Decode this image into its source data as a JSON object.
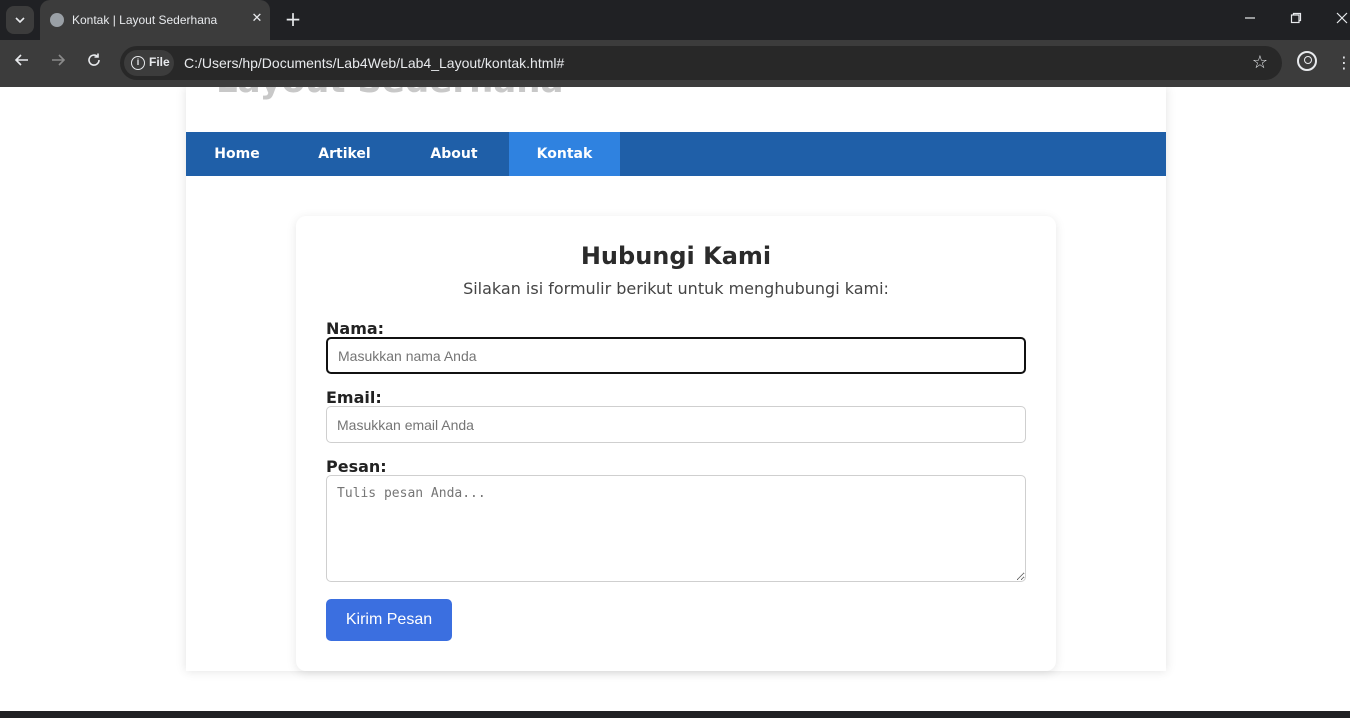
{
  "browser": {
    "tab_title": "Kontak | Layout Sederhana",
    "tab_close": "✕",
    "new_tab": "+",
    "site_chip": "File",
    "url": "C:/Users/hp/Documents/Lab4Web/Lab4_Layout/kontak.html#",
    "icons": [
      "tab-list-icon",
      "globe-icon",
      "close-icon",
      "plus-icon",
      "minimize-icon",
      "restore-icon",
      "close-window-icon",
      "back-icon",
      "forward-icon",
      "reload-icon",
      "info-icon",
      "star-icon",
      "profile-icon",
      "kebab-menu-icon"
    ]
  },
  "site": {
    "title": "Layout Sederhana",
    "nav": [
      "Home",
      "Artikel",
      "About",
      "Kontak"
    ],
    "active_nav": "Kontak",
    "colors": {
      "nav_bg": "#1f5fa8",
      "nav_active": "#2f82e0",
      "button": "#3b6fe0"
    }
  },
  "form": {
    "title": "Hubungi Kami",
    "subtitle": "Silakan isi formulir berikut untuk menghubungi kami:",
    "name_label": "Nama:",
    "name_placeholder": "Masukkan nama Anda",
    "email_label": "Email:",
    "email_placeholder": "Masukkan email Anda",
    "message_label": "Pesan:",
    "message_placeholder": "Tulis pesan Anda...",
    "submit_label": "Kirim Pesan"
  }
}
